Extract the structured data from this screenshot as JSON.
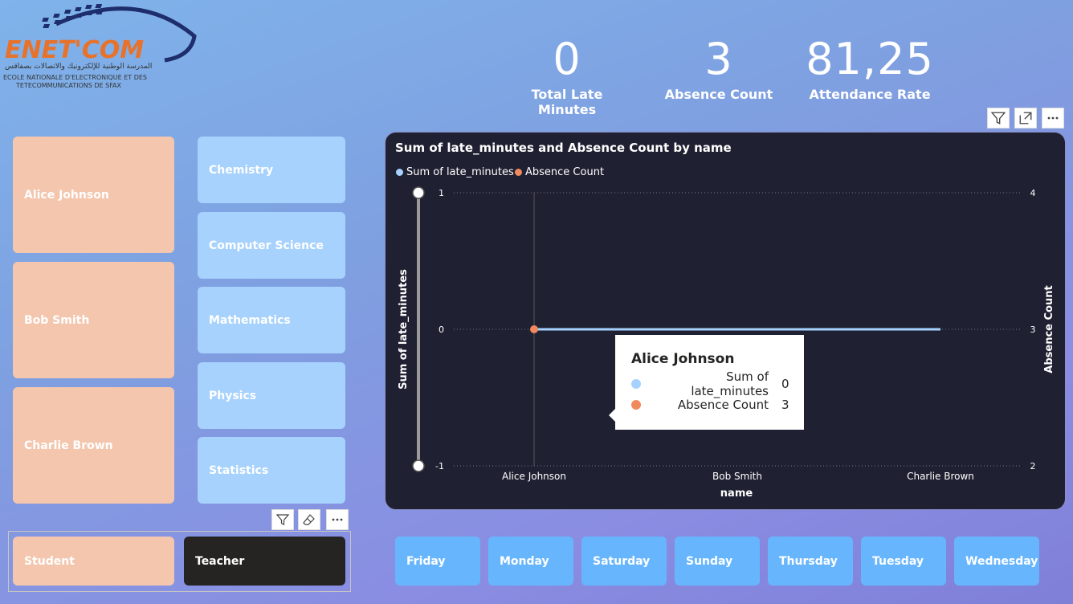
{
  "logo": {
    "name": "ENET'COM",
    "arabic": "المدرسة الوطنية للإلكترونيك والاتصالات بصفاقس",
    "line1": "ECOLE NATIONALE D'ELECTRONIQUE ET DES",
    "line2": "TETECOMMUNICATIONS DE SFAX"
  },
  "kpis": [
    {
      "value": "0",
      "label": "Total Late Minutes"
    },
    {
      "value": "3",
      "label": "Absence Count"
    },
    {
      "value": "81,25",
      "label": "Attendance Rate"
    }
  ],
  "students": [
    "Alice Johnson",
    "Bob Smith",
    "Charlie Brown"
  ],
  "subjects": [
    "Chemistry",
    "Computer Science",
    "Mathematics",
    "Physics",
    "Statistics"
  ],
  "roles": {
    "student": "Student",
    "teacher": "Teacher"
  },
  "days": [
    "Friday",
    "Monday",
    "Saturday",
    "Sunday",
    "Thursday",
    "Tuesday",
    "Wednesday"
  ],
  "icons": {
    "filter": "filter-icon",
    "focus": "focus-mode-icon",
    "more": "more-options-icon",
    "eraser": "eraser-icon"
  },
  "colors": {
    "peach": "#f4c6ae",
    "lightblue": "#a6d2fd",
    "dayblue": "#67b6fd",
    "dark": "#252423",
    "series1": "#a6d2fd",
    "series2": "#f08a5d"
  },
  "chart_data": {
    "type": "line",
    "title": "Sum of late_minutes and Absence Count by name",
    "xlabel": "name",
    "ylabel": "Sum of late_minutes",
    "y2label": "Absence Count",
    "categories": [
      "Alice Johnson",
      "Bob Smith",
      "Charlie Brown"
    ],
    "series": [
      {
        "name": "Sum of late_minutes",
        "axis": "left",
        "values": [
          0,
          0,
          0
        ],
        "color": "#a6d2fd"
      },
      {
        "name": "Absence Count",
        "axis": "right",
        "values": [
          3,
          null,
          null
        ],
        "color": "#f08a5d"
      }
    ],
    "ylim": [
      -1,
      1
    ],
    "y_ticks": [
      "1",
      "0",
      "-1"
    ],
    "y2lim": [
      2,
      4
    ],
    "y2_ticks": [
      "4",
      "3",
      "2"
    ],
    "legend": "top-left",
    "grid": true
  },
  "tooltip": {
    "name": "Alice Johnson",
    "rows": [
      {
        "label": "Sum of late_minutes",
        "value": "0"
      },
      {
        "label": "Absence Count",
        "value": "3"
      }
    ]
  }
}
